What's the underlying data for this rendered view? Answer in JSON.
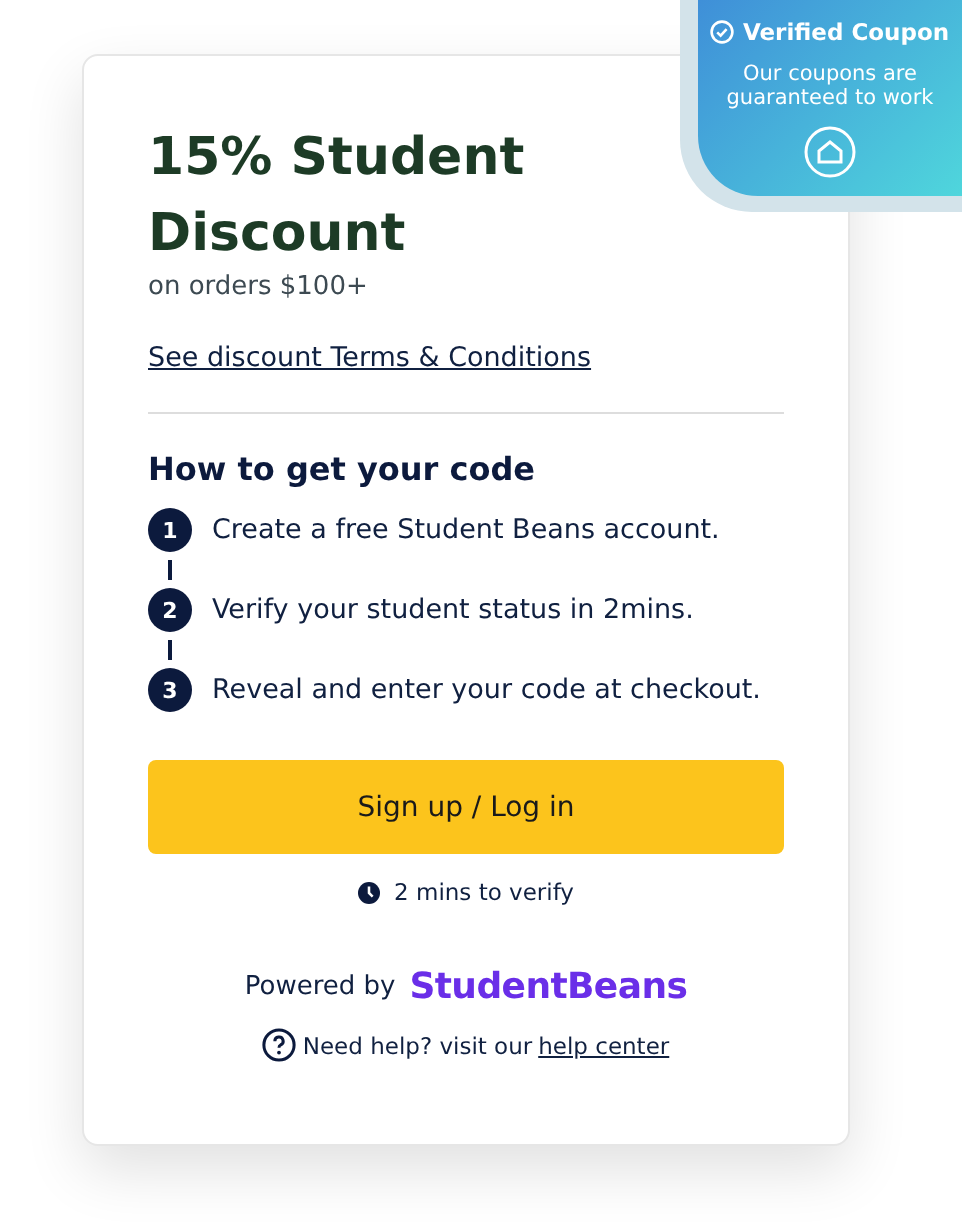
{
  "badge": {
    "title": "Verified Coupon",
    "text": "Our coupons are guaranteed to work"
  },
  "offer": {
    "title": "15% Student Discount",
    "subtitle": "on orders $100+",
    "terms_link": "See discount Terms & Conditions"
  },
  "how_to": {
    "heading": "How to get your code",
    "steps": [
      {
        "number": "1",
        "text": "Create a free Student Beans account."
      },
      {
        "number": "2",
        "text": "Verify your student status in 2mins."
      },
      {
        "number": "3",
        "text": "Reveal and enter your code at checkout."
      }
    ]
  },
  "button": "Sign up / Log in",
  "verify_note": "2 mins to verify",
  "powered": {
    "label": "Powered by",
    "brand": "StudentBeans"
  },
  "help": {
    "text": "Need help? visit our",
    "link": "help center"
  }
}
